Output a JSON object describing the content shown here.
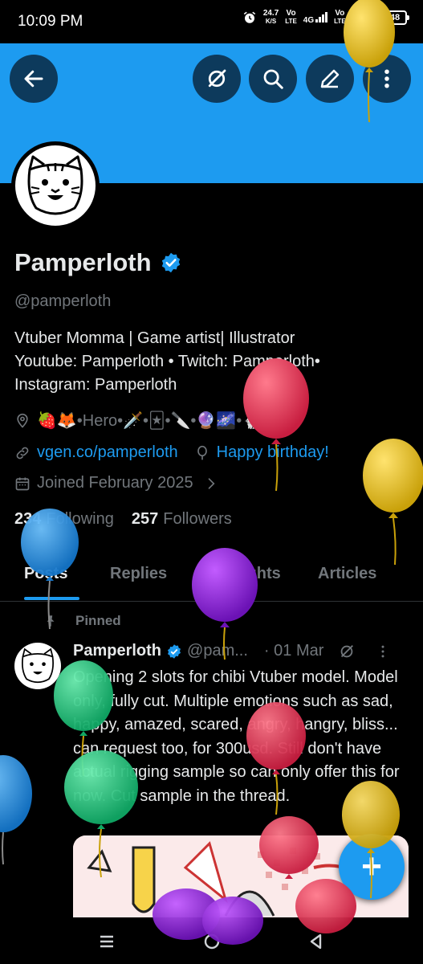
{
  "status_bar": {
    "time": "10:09 PM",
    "net_speed": "24.7",
    "net_unit": "K/S",
    "sim1_top": "Vo",
    "sim1_bottom": "LTE",
    "sim2_net": "4G",
    "sim3_top": "Vo",
    "sim3_bottom": "LTE",
    "sim4_net": "4G",
    "battery": "48"
  },
  "header": {
    "back_icon": "arrow-left-icon",
    "actions": [
      "no-circle-icon",
      "search-icon",
      "edit-pencil-icon",
      "more-vertical-icon"
    ],
    "banner_color": "#1d9bf0"
  },
  "profile": {
    "name": "Pamperloth",
    "handle": "@pamperloth",
    "bio_lines": [
      "Vtuber Momma | Game artist| Illustrator",
      "Youtube: Pamperloth • Twitch: Pamperloth•",
      "Instagram: Pamperloth"
    ],
    "location": "🍓🦊•Hero•🗡️•🃏•🔪•🔮🌌•🐇❤️",
    "website": "vgen.co/pamperloth",
    "birthday": "Happy birthday!",
    "joined": "Joined February 2025",
    "following_count": "234",
    "following_label": "Following",
    "followers_count": "257",
    "followers_label": "Followers"
  },
  "tabs": [
    "Posts",
    "Replies",
    "Highlights",
    "Articles"
  ],
  "active_tab": "Posts",
  "pinned_tweet": {
    "pinned_label": "Pinned",
    "author": "Pamperloth",
    "handle": "@pam...",
    "date": "· 01 Mar",
    "text": "Opening 2 slots for chibi Vtuber model. Model only, fully cut. Multiple emotions such as sad, happy, amazed, scared, angry, hangry, bliss... can request too,  for 300usd. Still don't have actual rigging sample so can only offer this for now. Cut sample in the thread."
  },
  "fab": {
    "label": "+"
  },
  "colors": {
    "accent": "#1d9bf0",
    "background": "#000000",
    "text": "#e7e9ea",
    "muted": "#71767b"
  }
}
